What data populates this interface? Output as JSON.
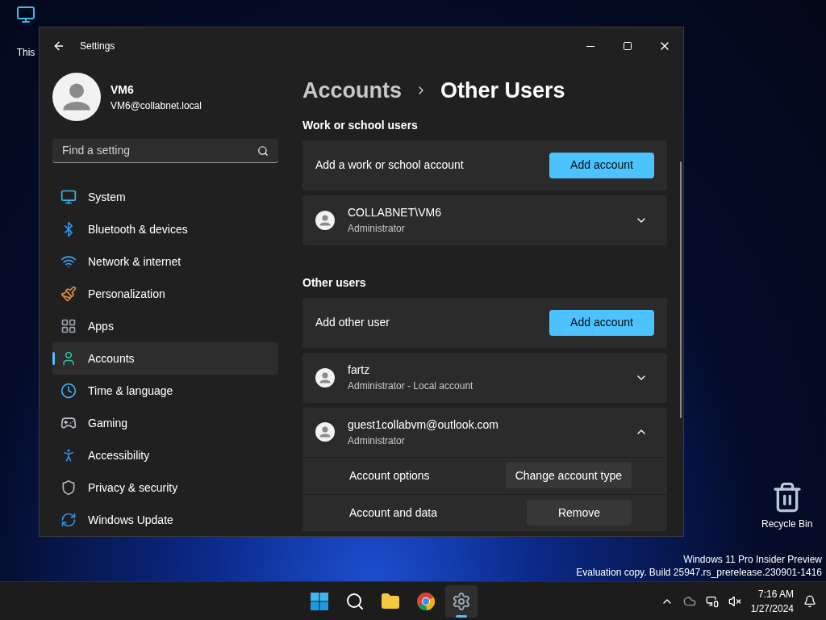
{
  "desktop": {
    "icons": [
      {
        "label": "This",
        "kind": "pc"
      },
      {
        "label": "Recycle Bin",
        "kind": "bin"
      }
    ],
    "watermark": [
      "Windows 11 Pro Insider Preview",
      "Evaluation copy. Build 25947.rs_prerelease.230901-1416"
    ]
  },
  "window": {
    "title": "Settings"
  },
  "profile": {
    "name": "VM6",
    "email": "VM6@collabnet.local"
  },
  "search": {
    "placeholder": "Find a setting"
  },
  "nav": [
    {
      "label": "System",
      "selected": false
    },
    {
      "label": "Bluetooth & devices",
      "selected": false
    },
    {
      "label": "Network & internet",
      "selected": false
    },
    {
      "label": "Personalization",
      "selected": false
    },
    {
      "label": "Apps",
      "selected": false
    },
    {
      "label": "Accounts",
      "selected": true
    },
    {
      "label": "Time & language",
      "selected": false
    },
    {
      "label": "Gaming",
      "selected": false
    },
    {
      "label": "Accessibility",
      "selected": false
    },
    {
      "label": "Privacy & security",
      "selected": false
    },
    {
      "label": "Windows Update",
      "selected": false
    }
  ],
  "breadcrumb": [
    "Accounts",
    "Other Users"
  ],
  "sections": [
    {
      "heading": "Work or school users",
      "action": {
        "label": "Add a work or school account",
        "button": "Add account"
      },
      "users": [
        {
          "name": "COLLABNET\\VM6",
          "role": "Administrator",
          "expanded": false
        }
      ]
    },
    {
      "heading": "Other users",
      "action": {
        "label": "Add other user",
        "button": "Add account"
      },
      "users": [
        {
          "name": "fartz",
          "role": "Administrator - Local account",
          "expanded": false
        },
        {
          "name": "guest1collabvm@outlook.com",
          "role": "Administrator",
          "expanded": true,
          "options": [
            {
              "label": "Account options",
              "button": "Change account type"
            },
            {
              "label": "Account and data",
              "button": "Remove"
            }
          ]
        }
      ]
    }
  ],
  "taskbar": {
    "apps": [
      {
        "kind": "start",
        "selected": false
      },
      {
        "kind": "search",
        "selected": false
      },
      {
        "kind": "folder",
        "selected": false
      },
      {
        "kind": "browser",
        "selected": false
      },
      {
        "kind": "settings",
        "selected": true
      }
    ],
    "clock": {
      "time": "7:16 AM",
      "date": "1/27/2024"
    }
  }
}
